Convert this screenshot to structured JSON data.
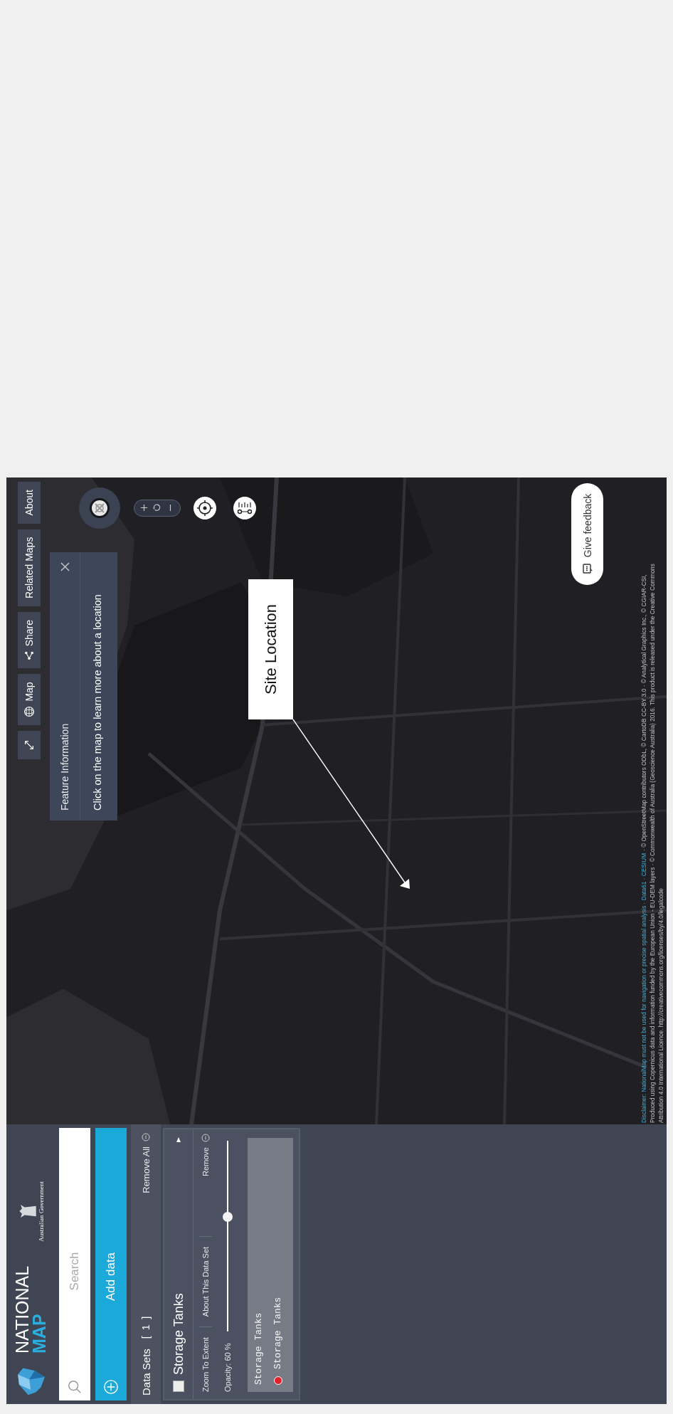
{
  "sidebar": {
    "logo": {
      "title": "NATIONAL",
      "subtitle": "MAP"
    },
    "government": "Australian Government",
    "search": {
      "placeholder": "Search"
    },
    "add_data": "Add data",
    "data_sets": {
      "label": "Data Sets",
      "count": "[ 1 ]",
      "remove_all": "Remove All"
    },
    "datasets": [
      {
        "title": "Storage Tanks",
        "checked": false,
        "actions": [
          {
            "label": "Zoom To Extent",
            "kind": "plain"
          },
          {
            "label": "About This Data Set",
            "kind": "plain"
          },
          {
            "label": "Remove",
            "kind": "info"
          }
        ],
        "opacity": "Opacity: 60 %",
        "level": 0.6,
        "legend": {
          "title": "Storage Tanks",
          "items": [
            {
              "label": "Storage Tanks",
              "color": "#e3202b"
            }
          ]
        }
      }
    ]
  },
  "map": {
    "toolbar": [
      {
        "kind": "expand"
      },
      {
        "kind": "globe",
        "label": "Map"
      },
      {
        "kind": "share",
        "label": "Share"
      },
      {
        "kind": "plain",
        "label": "Related Maps"
      },
      {
        "kind": "plain",
        "label": "About"
      }
    ],
    "feature_info": {
      "title": "Feature Information",
      "message": "Click on the map to learn more about a location"
    },
    "annotation": {
      "label": "Site Location"
    },
    "feedback": "Give feedback",
    "attribution": [
      {
        "segments": [
          {
            "text": "Disclaimer: NationalMap must not be used for navigation or precise spatial analysis · Data61 · CESIUM",
            "link": true
          },
          {
            "text": "· © OpenStreetMap contributors ODbL, © CartoDB CC-BY 3.0 · © Analytical Graphics Inc., © CGIAR-CSI,",
            "link": false
          }
        ]
      },
      {
        "segments": [
          {
            "text": "Produced using Copernicus data and information funded by the European Union - EU-DEM layers · © Commonwealth of Australia (Geoscience Australia) 2016. This product is released under the Creative Commons",
            "link": false
          }
        ]
      },
      {
        "segments": [
          {
            "text": "Attribution 4.0 International Licence. http://creativecommons.org/licenses/by/4.0/legalcode",
            "link": false
          }
        ]
      }
    ]
  }
}
